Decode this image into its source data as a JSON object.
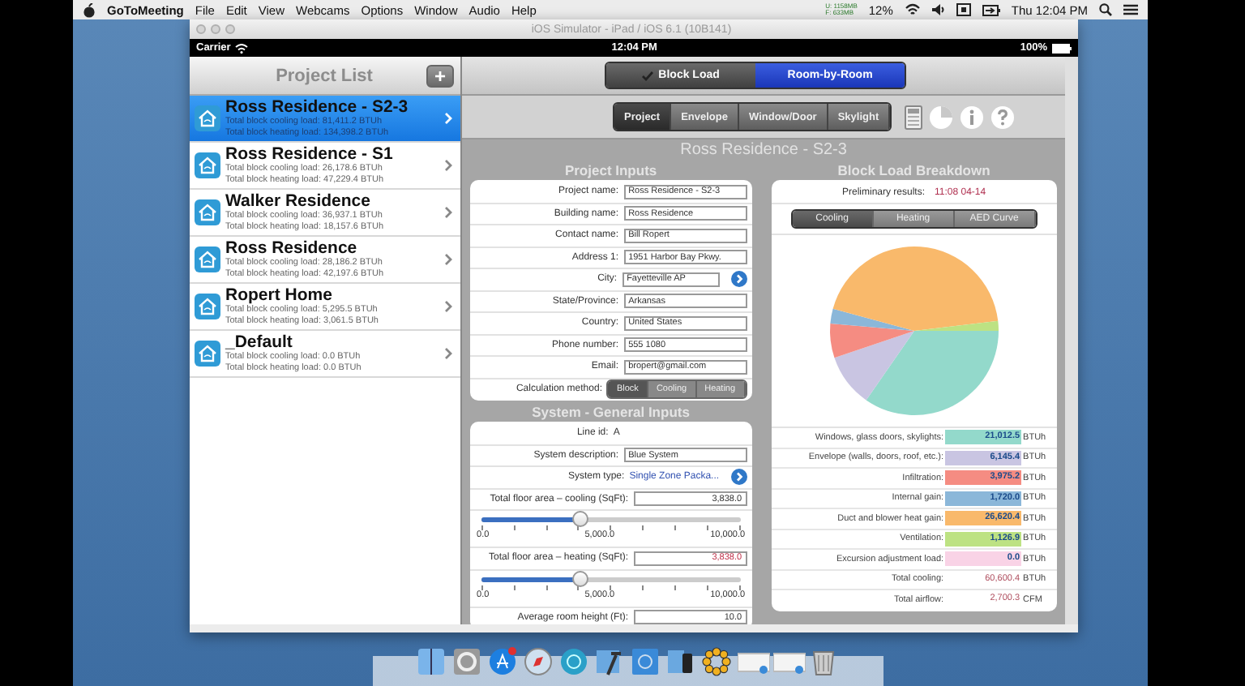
{
  "menu_bar": {
    "app_name": "GoToMeeting",
    "items": [
      "File",
      "Edit",
      "View",
      "Webcams",
      "Options",
      "Window",
      "Audio",
      "Help"
    ],
    "memory": [
      "U: 1158MB",
      "F: 633MB"
    ],
    "battery_percent": "12%",
    "clock": "Thu 12:04 PM"
  },
  "window": {
    "title": "iOS Simulator - iPad / iOS 6.1 (10B141)"
  },
  "status_bar": {
    "carrier": "Carrier",
    "time": "12:04 PM",
    "battery": "100%"
  },
  "project_list": {
    "title": "Project List",
    "add_button": "+",
    "items": [
      {
        "name": "Ross Residence - S2-3",
        "cooling": "Total block cooling load: 81,411.2 BTUh",
        "heating": "Total block heating load: 134,398.2 BTUh",
        "selected": true
      },
      {
        "name": "Ross Residence - S1",
        "cooling": "Total block cooling load: 26,178.6 BTUh",
        "heating": "Total block heating load: 47,229.4 BTUh",
        "selected": false
      },
      {
        "name": "Walker Residence",
        "cooling": "Total block cooling load: 36,937.1 BTUh",
        "heating": "Total block heating load: 18,157.6 BTUh",
        "selected": false
      },
      {
        "name": "Ross Residence",
        "cooling": "Total block cooling load: 28,186.2 BTUh",
        "heating": "Total block heating load: 42,197.6 BTUh",
        "selected": false
      },
      {
        "name": "Ropert Home",
        "cooling": "Total block cooling load: 5,295.5 BTUh",
        "heating": "Total block heating load: 3,061.5 BTUh",
        "selected": false
      },
      {
        "name": "_Default",
        "cooling": "Total block cooling load: 0.0 BTUh",
        "heating": "Total block heating load: 0.0 BTUh",
        "selected": false
      }
    ]
  },
  "mode_tabs": [
    {
      "label": "Block Load",
      "checked": true,
      "selected": false
    },
    {
      "label": "Room-by-Room",
      "checked": false,
      "selected": true
    }
  ],
  "section_tabs": [
    {
      "label": "Project",
      "selected": true
    },
    {
      "label": "Envelope",
      "selected": false
    },
    {
      "label": "Window/Door",
      "selected": false
    },
    {
      "label": "Skylight",
      "selected": false
    }
  ],
  "project_title": "Ross Residence - S2-3",
  "project_inputs": {
    "title": "Project Inputs",
    "fields": [
      {
        "kind": "field",
        "label": "Project name:",
        "value": "Ross Residence - S2-3"
      },
      {
        "kind": "field",
        "label": "Building name:",
        "value": "Ross Residence"
      },
      {
        "kind": "field",
        "label": "Contact name:",
        "value": "Bill Ropert"
      },
      {
        "kind": "field",
        "label": "Address 1:",
        "value": "1951 Harbor Bay Pkwy."
      },
      {
        "kind": "picker",
        "label": "City:",
        "value": "Fayetteville AP"
      },
      {
        "kind": "field",
        "label": "State/Province:",
        "value": "Arkansas"
      },
      {
        "kind": "field",
        "label": "Country:",
        "value": "United States"
      },
      {
        "kind": "field",
        "label": "Phone number:",
        "value": "555 1080"
      },
      {
        "kind": "field",
        "label": "Email:",
        "value": "bropert@gmail.com"
      }
    ],
    "calculation_method": {
      "label": "Calculation method:",
      "segments": [
        {
          "label": "Block",
          "selected": true
        },
        {
          "label": "Cooling",
          "selected": false
        },
        {
          "label": "Heating",
          "selected": false
        }
      ]
    }
  },
  "system_inputs": {
    "title": "System - General Inputs",
    "rows": [
      {
        "kind": "text",
        "label": "Line id:",
        "value": "A"
      },
      {
        "kind": "field",
        "label": "System description:",
        "value": "Blue System",
        "flagged": false
      },
      {
        "kind": "picker",
        "label": "System type:",
        "value": "Single Zone Packa..."
      },
      {
        "kind": "field",
        "label": "Total floor area – cooling (SqFt):",
        "value": "3,838.0",
        "flagged": false
      },
      {
        "kind": "slider",
        "level": 0.38,
        "ticks": [
          "0.0",
          "5,000.0",
          "10,000.0"
        ]
      },
      {
        "kind": "field",
        "label": "Total floor area – heating (SqFt):",
        "value": "3,838.0",
        "flagged": true
      },
      {
        "kind": "slider",
        "level": 0.38,
        "ticks": [
          "0.0",
          "5,000.0",
          "10,000.0"
        ]
      },
      {
        "kind": "field",
        "label": "Average room height (Ft):",
        "value": "10.0",
        "flagged": false
      }
    ]
  },
  "block_load": {
    "title": "Block Load Breakdown",
    "preliminary_label": "Preliminary results:",
    "preliminary_time": "11:08 04-14",
    "tabs": [
      {
        "label": "Cooling",
        "selected": true
      },
      {
        "label": "Heating",
        "selected": false
      },
      {
        "label": "AED Curve",
        "selected": false
      }
    ],
    "chart_data": {
      "type": "pie",
      "values": [
        34.67,
        10.14,
        6.56,
        2.84,
        43.93,
        1.86
      ]
    },
    "rows": [
      {
        "kind": "load",
        "label": "Windows, glass doors, skylights:",
        "value": "21,012.5",
        "unit": "BTUh",
        "color": "#93d9cb"
      },
      {
        "kind": "load",
        "label": "Envelope (walls, doors, roof, etc.):",
        "value": "6,145.4",
        "unit": "BTUh",
        "color": "#c9c5e2"
      },
      {
        "kind": "load",
        "label": "Infiltration:",
        "value": "3,975.2",
        "unit": "BTUh",
        "color": "#f58c82"
      },
      {
        "kind": "load",
        "label": "Internal gain:",
        "value": "1,720.0",
        "unit": "BTUh",
        "color": "#8bb7d9"
      },
      {
        "kind": "load",
        "label": "Duct and blower heat gain:",
        "value": "26,620.4",
        "unit": "BTUh",
        "color": "#f9b96b"
      },
      {
        "kind": "load",
        "label": "Ventilation:",
        "value": "1,126.9",
        "unit": "BTUh",
        "color": "#bde283"
      },
      {
        "kind": "load",
        "label": "Excursion adjustment load:",
        "value": "0.0",
        "unit": "BTUh",
        "color": "#f9d3e6"
      },
      {
        "kind": "total",
        "label": "Total cooling:",
        "value": "60,600.4",
        "unit": "BTUh"
      },
      {
        "kind": "total",
        "label": "Total airflow:",
        "value": "2,700.3",
        "unit": "CFM"
      }
    ]
  }
}
